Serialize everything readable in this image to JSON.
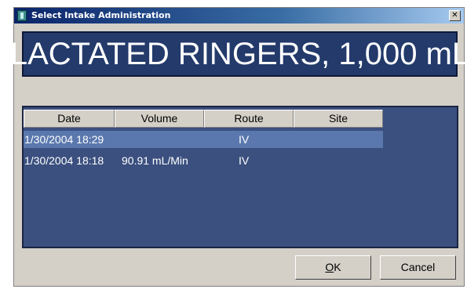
{
  "window": {
    "title": "Select Intake Administration",
    "close_glyph": "✕"
  },
  "banner": {
    "text": "LACTATED RINGERS, 1,000 mL",
    "background": "#233a6a"
  },
  "table": {
    "columns": [
      "Date",
      "Volume",
      "Route",
      "Site"
    ],
    "rows": [
      {
        "date": "1/30/2004 18:29",
        "volume": "",
        "route": "IV",
        "site": "",
        "selected": true
      },
      {
        "date": "1/30/2004 18:18",
        "volume": "90.91 mL/Min",
        "route": "IV",
        "site": "",
        "selected": false
      }
    ],
    "background": "#3b507f",
    "selection_color": "#5a78ad"
  },
  "buttons": {
    "ok_label": "OK",
    "ok_mnemonic": "O",
    "ok_rest": "K",
    "cancel_label": "Cancel"
  }
}
